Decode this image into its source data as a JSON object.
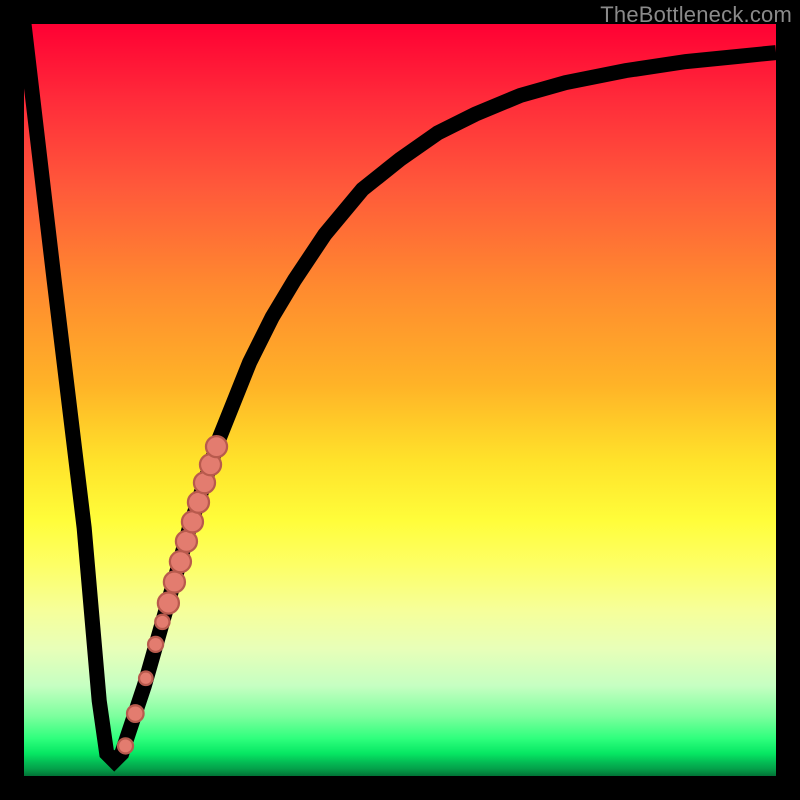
{
  "watermark": "TheBottleneck.com",
  "chart_data": {
    "type": "line",
    "title": "",
    "xlabel": "",
    "ylabel": "",
    "xlim": [
      0,
      100
    ],
    "ylim": [
      0,
      100
    ],
    "grid": false,
    "legend": false,
    "series": [
      {
        "name": "bottleneck-curve",
        "x": [
          0,
          4,
          8,
          10,
          11,
          12,
          13,
          14,
          16,
          18,
          20,
          22,
          24,
          26,
          28,
          30,
          33,
          36,
          40,
          45,
          50,
          55,
          60,
          66,
          72,
          80,
          88,
          95,
          100
        ],
        "y": [
          100,
          66,
          33,
          10,
          3,
          2,
          3,
          6,
          12,
          19,
          26,
          33,
          39,
          45,
          50,
          55,
          61,
          66,
          72,
          78,
          82,
          85.5,
          88,
          90.5,
          92.2,
          93.8,
          95,
          95.7,
          96.2
        ]
      }
    ],
    "markers": [
      {
        "x": 13.5,
        "y": 4.0,
        "r": 1.0
      },
      {
        "x": 14.8,
        "y": 8.3,
        "r": 1.1
      },
      {
        "x": 16.2,
        "y": 13.0,
        "r": 0.9
      },
      {
        "x": 17.5,
        "y": 17.5,
        "r": 1.0
      },
      {
        "x": 18.4,
        "y": 20.5,
        "r": 0.95
      },
      {
        "x": 19.2,
        "y": 23.0,
        "r": 1.4
      },
      {
        "x": 20.0,
        "y": 25.8,
        "r": 1.4
      },
      {
        "x": 20.8,
        "y": 28.5,
        "r": 1.4
      },
      {
        "x": 21.6,
        "y": 31.2,
        "r": 1.4
      },
      {
        "x": 22.4,
        "y": 33.8,
        "r": 1.4
      },
      {
        "x": 23.2,
        "y": 36.4,
        "r": 1.4
      },
      {
        "x": 24.0,
        "y": 39.0,
        "r": 1.4
      },
      {
        "x": 24.8,
        "y": 41.4,
        "r": 1.4
      },
      {
        "x": 25.6,
        "y": 43.8,
        "r": 1.4
      }
    ],
    "background_gradient_note": "vertical red-to-green gradient, green at bottom",
    "frame_color": "#000000"
  }
}
